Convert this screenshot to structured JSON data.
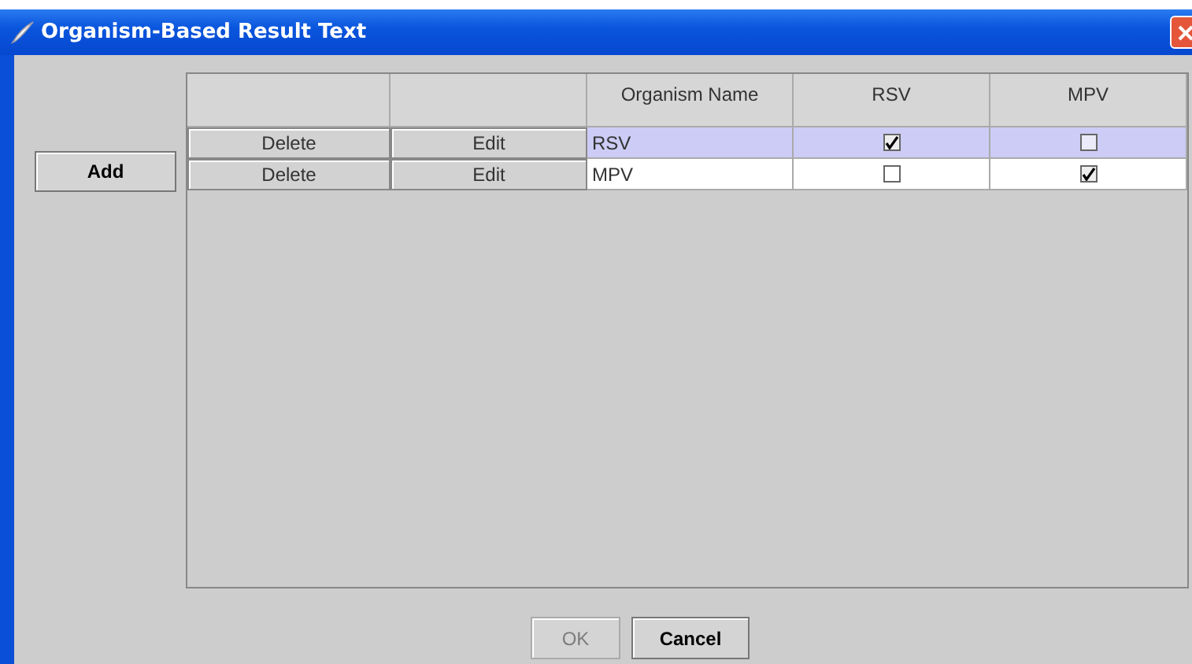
{
  "window": {
    "title": "Organism-Based Result Text"
  },
  "add_button": "Add",
  "table": {
    "columns": [
      "",
      "",
      "Organism Name",
      "RSV",
      "MPV"
    ],
    "rows": [
      {
        "selected": true,
        "delete": "Delete",
        "edit": "Edit",
        "organism_name": "RSV",
        "rsv": true,
        "mpv": false
      },
      {
        "selected": false,
        "delete": "Delete",
        "edit": "Edit",
        "organism_name": "MPV",
        "rsv": false,
        "mpv": true
      }
    ]
  },
  "buttons": [
    {
      "label": "OK",
      "disabled": true
    },
    {
      "label": "Cancel",
      "disabled": false
    }
  ]
}
